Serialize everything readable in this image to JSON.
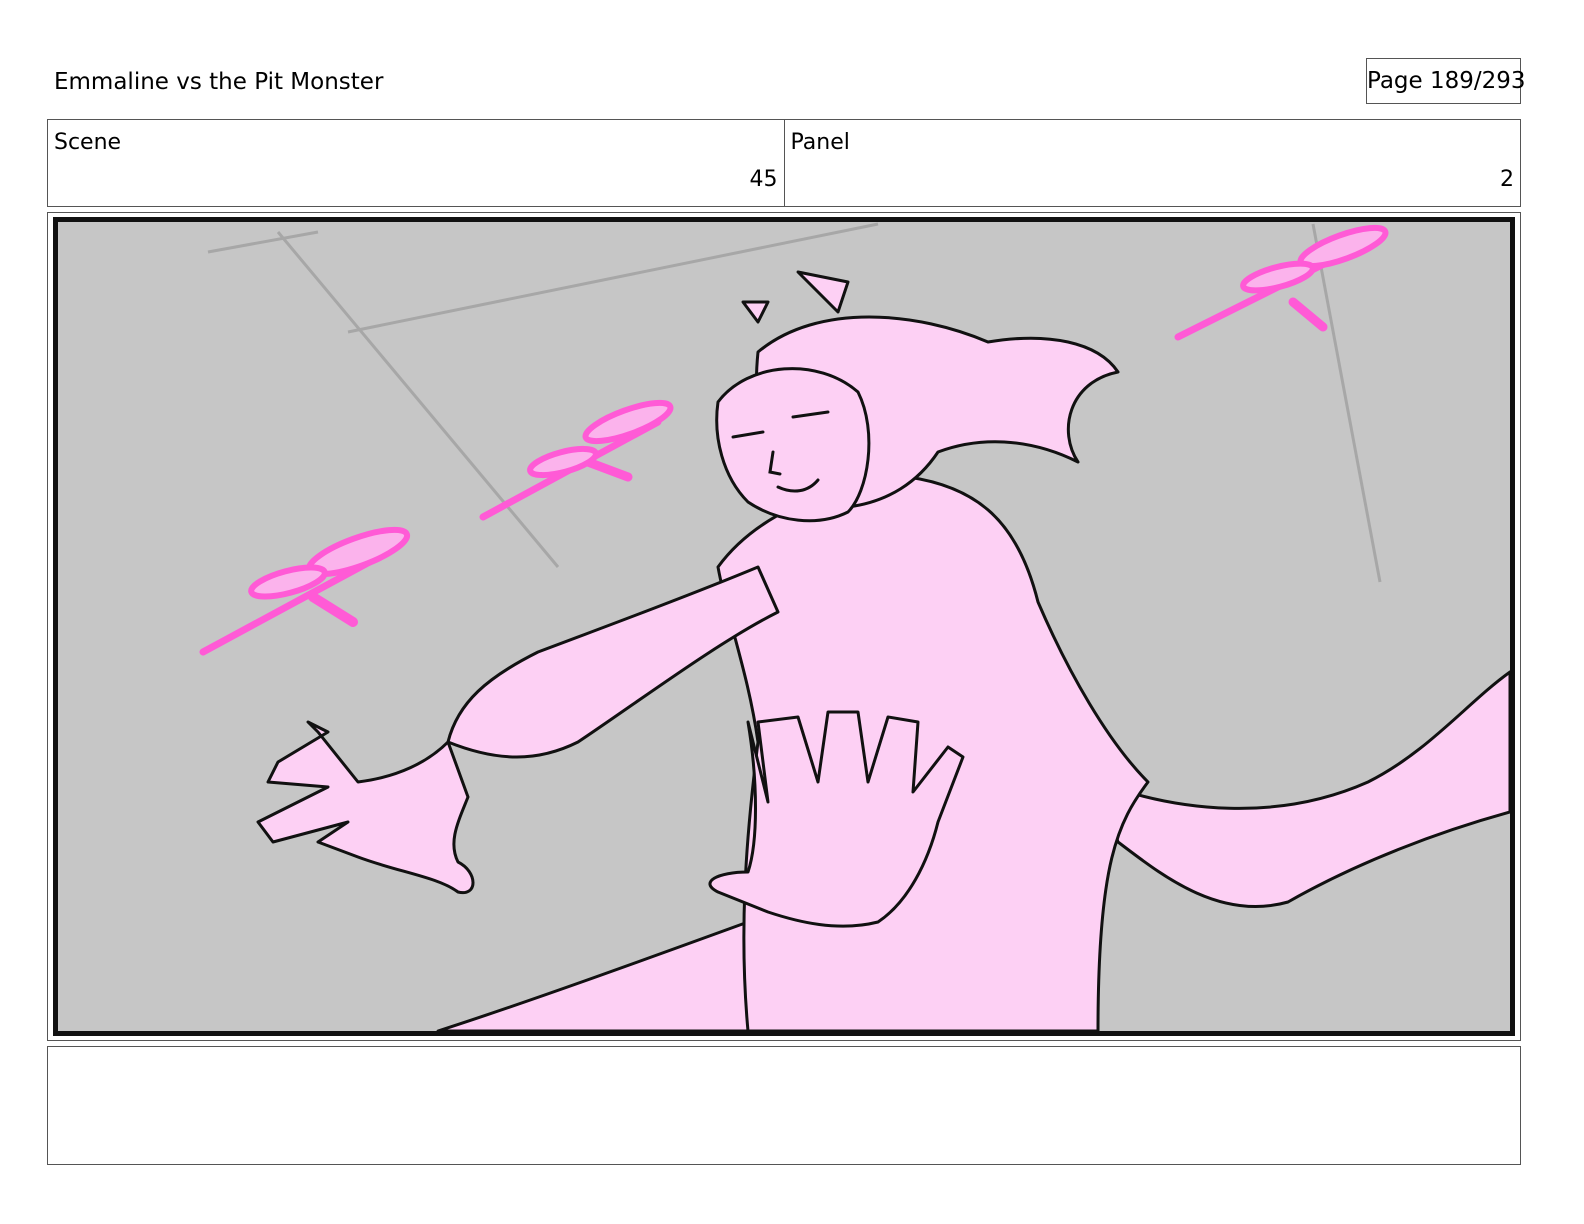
{
  "document": {
    "title": "Emmaline vs the Pit Monster",
    "page_label": "Page 189/293"
  },
  "panel_info": {
    "scene_label": "Scene",
    "scene_number": "45",
    "panel_label": "Panel",
    "panel_number": "2"
  },
  "artwork": {
    "description_icon": "storyboard-sketch",
    "colors": {
      "background": "#c6c6c6",
      "figure_fill": "#fdd0f4",
      "line": "#111111",
      "accent_projectiles": "#ff5ad6"
    }
  },
  "notes": {
    "text": ""
  }
}
